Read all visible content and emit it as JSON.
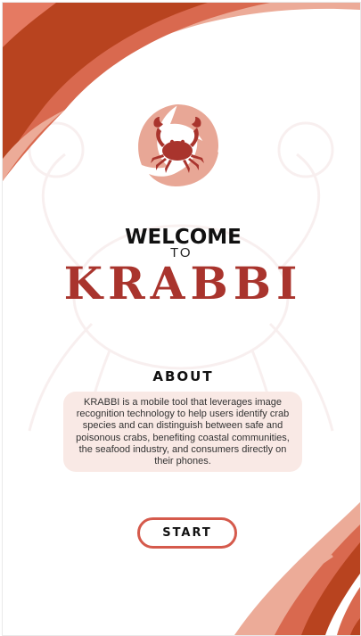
{
  "colors": {
    "primary": "#a9342d",
    "accent": "#d55a4c",
    "soft": "#e8a796",
    "card": "#f9e9e5"
  },
  "logo": {
    "icon": "crab-icon"
  },
  "welcome": {
    "line1": "WELCOME",
    "line2": "TO",
    "brand": "KRABBI"
  },
  "about": {
    "heading": "ABOUT",
    "body": "KRABBI is a mobile tool that leverages image recognition technology to help users identify crab species and can distinguish between safe and poisonous crabs, benefiting coastal communities, the seafood industry, and consumers directly on their phones."
  },
  "actions": {
    "start_label": "START"
  }
}
